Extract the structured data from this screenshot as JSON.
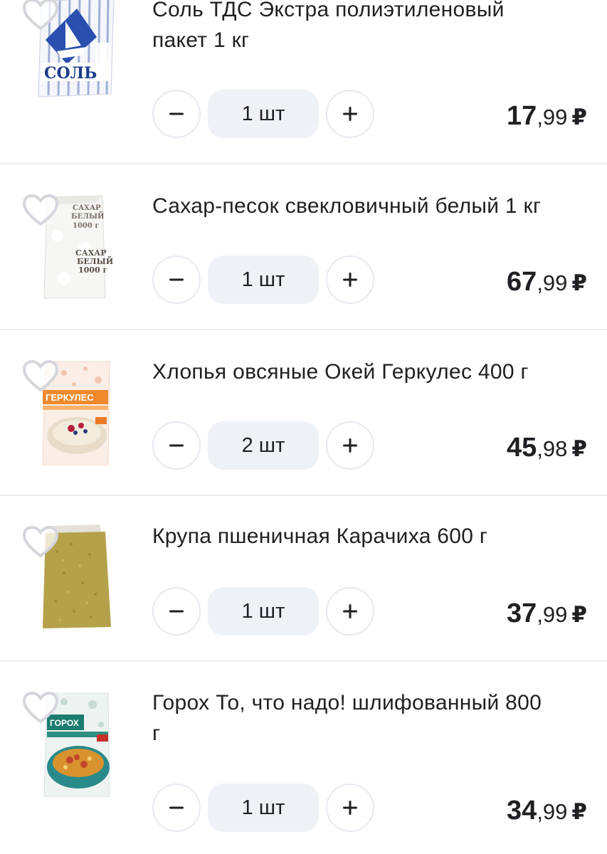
{
  "products": [
    {
      "title_lines": [
        "Соль ТДС Экстра полиэтиленовый",
        "пакет 1 кг"
      ],
      "qty": "1 шт",
      "price_rub": "17",
      "price_kop": ",99",
      "currency": "₽",
      "image_icon": "salt-pack-icon",
      "package_text": "СОЛЬ"
    },
    {
      "title_lines": [
        "Сахар-песок свекловичный белый 1 кг"
      ],
      "qty": "1 шт",
      "price_rub": "67",
      "price_kop": ",99",
      "currency": "₽",
      "image_icon": "sugar-pack-icon",
      "package_text": [
        "САХАР",
        "БЕЛЫЙ",
        "1000 г"
      ]
    },
    {
      "title_lines": [
        "Хлопья овсяные Окей Геркулес 400 г"
      ],
      "qty": "2 шт",
      "price_rub": "45",
      "price_kop": ",98",
      "currency": "₽",
      "image_icon": "oat-flakes-pack-icon",
      "package_text": "ГЕРКУЛЕС"
    },
    {
      "title_lines": [
        "Крупа пшеничная Карачиха 600 г"
      ],
      "qty": "1 шт",
      "price_rub": "37",
      "price_kop": ",99",
      "currency": "₽",
      "image_icon": "wheat-groats-pack-icon"
    },
    {
      "title_lines": [
        "Горох То, что надо! шлифованный 800",
        "г"
      ],
      "qty": "1 шт",
      "price_rub": "34",
      "price_kop": ",99",
      "currency": "₽",
      "image_icon": "peas-pack-icon",
      "package_text": "ГОРОХ"
    }
  ],
  "colors": {
    "divider": "#eceef2",
    "qty_bg": "#eef1f6",
    "button_border": "#e6e9ef",
    "text": "#1f1f24"
  },
  "icons": {
    "favorite": "heart-outline-icon",
    "decrease": "minus-icon",
    "increase": "plus-icon"
  }
}
